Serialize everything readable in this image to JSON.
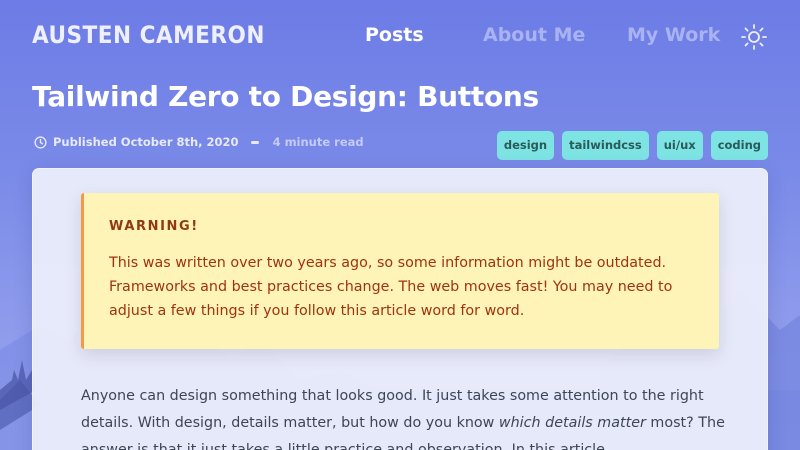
{
  "header": {
    "brand": "AUSTEN CAMERON",
    "nav": [
      {
        "label": "Posts",
        "active": true
      },
      {
        "label": "About Me",
        "active": false
      },
      {
        "label": "My Work",
        "active": false
      }
    ],
    "theme_toggle_icon": "sun-icon"
  },
  "post": {
    "title": "Tailwind Zero to Design: Buttons",
    "published_icon": "clock-icon",
    "published": "Published October 8th, 2020",
    "read_time": "4 minute read",
    "tags": [
      "design",
      "tailwindcss",
      "ui/ux",
      "coding"
    ]
  },
  "warning": {
    "title": "WARNING!",
    "body": "This was written over two years ago, so some information might be outdated. Frameworks and best practices change. The web moves fast! You may need to adjust a few things if you follow this article word for word."
  },
  "article": {
    "p1_part1": "Anyone can design something that looks good. It just takes some attention to the right details. With design, details matter, but how do you know ",
    "p1_emphasis": "which details matter",
    "p1_part2": " most? The answer is that it just takes a little practice and observation. In this article"
  },
  "colors": {
    "background_top": "#6d7ce6",
    "tag_bg": "#7ee3e3",
    "warning_bg": "#fff4b8",
    "warning_border": "#f29a45",
    "warning_text": "#a0330f"
  }
}
